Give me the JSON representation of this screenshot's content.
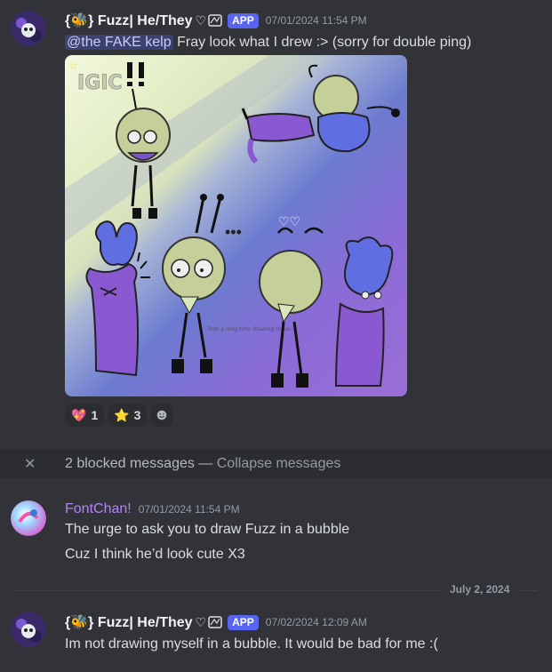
{
  "messages": [
    {
      "username": "{🐝} Fuzz| He/They",
      "heart": "♡",
      "tag": "APP",
      "timestamp": "07/01/2024 11:54 PM",
      "mention": "@the FAKE kelp",
      "text": " Fray look what I drew :> (sorry for double ping)"
    },
    {
      "username": "FontChan!",
      "timestamp": "07/01/2024 11:54 PM",
      "lines": [
        "The urge to ask you to draw Fuzz in a bubble",
        "Cuz I think he’d look cute X3"
      ]
    },
    {
      "username": "{🐝} Fuzz| He/They",
      "heart": "♡",
      "tag": "APP",
      "timestamp": "07/02/2024 12:09 AM",
      "text": "Im not drawing myself in a bubble. It would be bad for me :("
    }
  ],
  "reactions": [
    {
      "emoji": "💖",
      "count": "1"
    },
    {
      "emoji": "⭐",
      "count": "3"
    }
  ],
  "add_reaction_icon": "smile-icon",
  "blocked": {
    "close_icon": "✕",
    "text": "2 blocked messages — ",
    "link": "Collapse messages"
  },
  "date_divider": "July 2, 2024",
  "artwork": {
    "ig_text": "IGIC",
    "caption": "Took a long time drawing these"
  },
  "colors": {
    "bg": "#313338",
    "tag": "#5865f2",
    "mention_bg": "#3c4270",
    "fontchan_name": "#b485f5"
  }
}
